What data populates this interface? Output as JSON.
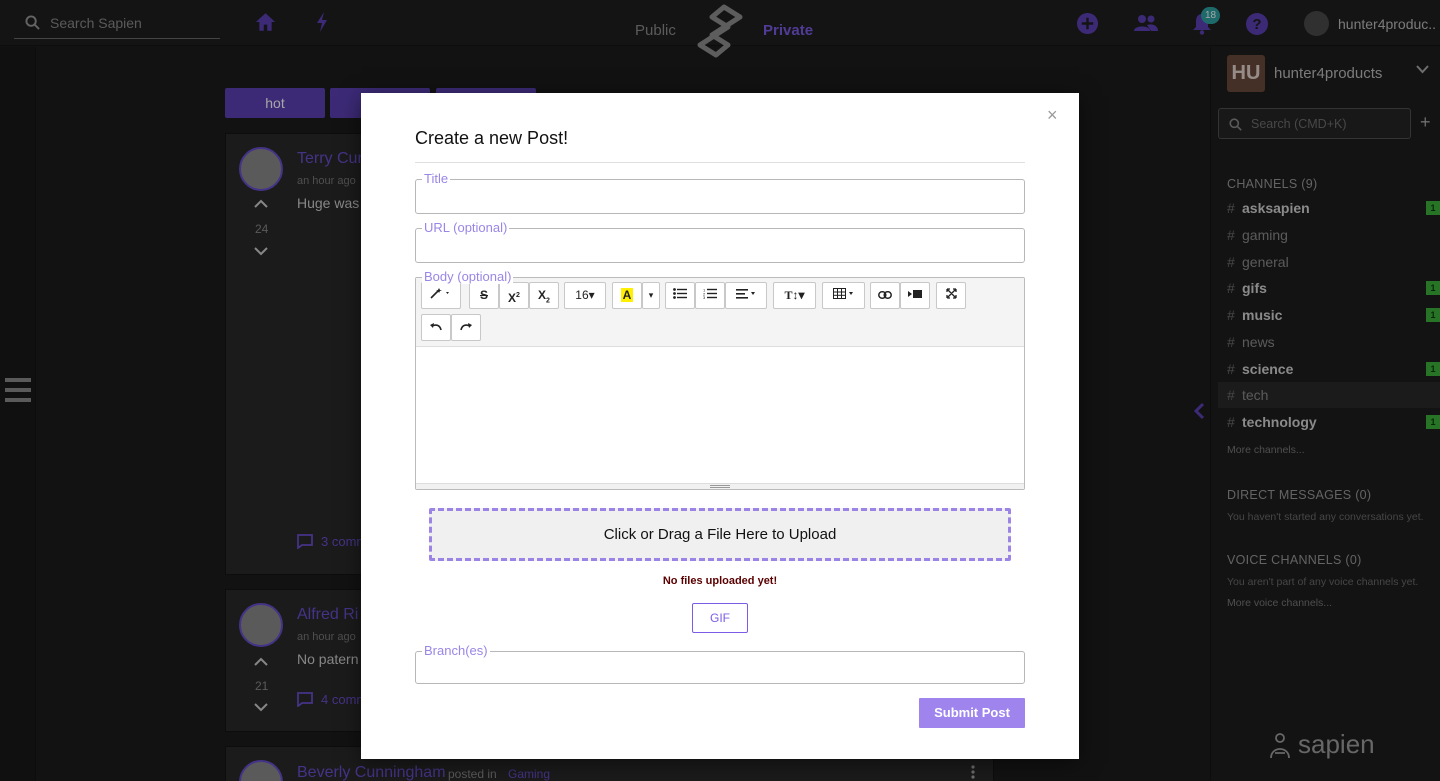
{
  "topbar": {
    "search_placeholder": "Search Sapien",
    "tab_public": "Public",
    "tab_private": "Private",
    "notification_count": "18",
    "username": "hunter4produc.."
  },
  "feed": {
    "sort_buttons": [
      "hot",
      "",
      ""
    ],
    "posts": [
      {
        "name": "Terry Cur",
        "time": "an hour ago",
        "body": "Huge was",
        "votes": "24",
        "comments": "3 comm"
      },
      {
        "name": "Alfred Ri",
        "time": "an hour ago",
        "body": "No patern",
        "votes": "21",
        "comments": "4 comm"
      },
      {
        "name": "Beverly Cunningham",
        "posted_in": "posted in",
        "channel": "Gaming"
      }
    ]
  },
  "sidebar": {
    "team_initials": "HU",
    "team_name": "hunter4products",
    "search_placeholder": "Search (CMD+K)",
    "channels_header": "CHANNELS (9)",
    "channels": [
      {
        "name": "asksapien",
        "bold": true,
        "count": "1"
      },
      {
        "name": "gaming",
        "bold": false,
        "count": ""
      },
      {
        "name": "general",
        "bold": false,
        "count": ""
      },
      {
        "name": "gifs",
        "bold": true,
        "count": "1"
      },
      {
        "name": "music",
        "bold": true,
        "count": "1"
      },
      {
        "name": "news",
        "bold": false,
        "count": ""
      },
      {
        "name": "science",
        "bold": true,
        "count": "1"
      },
      {
        "name": "tech",
        "bold": false,
        "count": "",
        "selected": true
      },
      {
        "name": "technology",
        "bold": true,
        "count": "1"
      }
    ],
    "more_channels": "More channels...",
    "dm_header": "DIRECT MESSAGES (0)",
    "dm_note": "You haven't started any conversations yet.",
    "voice_header": "VOICE CHANNELS (0)",
    "voice_note": "You aren't part of any voice channels yet.",
    "more_voice": "More voice channels...",
    "brand": "sapien"
  },
  "modal": {
    "title": "Create a new Post!",
    "close": "×",
    "title_label": "Title",
    "url_label": "URL (optional)",
    "body_label": "Body (optional)",
    "font_size": "16",
    "upload_text": "Click or Drag a File Here to Upload",
    "no_files": "No files uploaded yet!",
    "gif_label": "GIF",
    "branches_label": "Branch(es)",
    "submit_label": "Submit Post"
  }
}
